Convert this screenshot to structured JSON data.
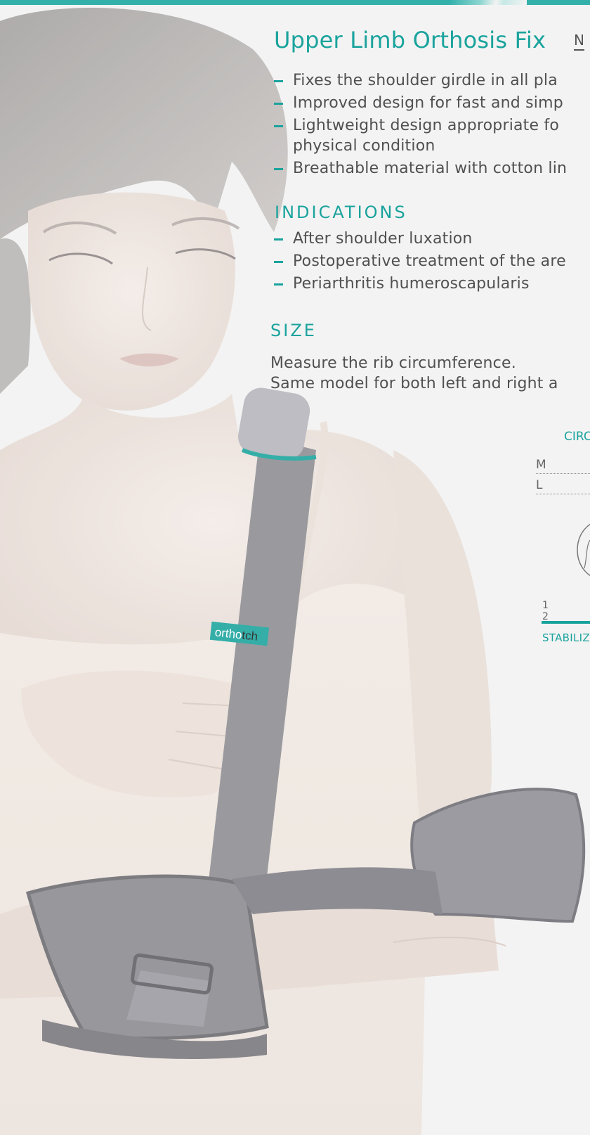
{
  "product": {
    "title": "Upper Limb Orthosis Fix",
    "code": "N"
  },
  "features": [
    "Fixes the shoulder girdle in all pla",
    "Improved design for fast and simp",
    "Lightweight design appropriate fo",
    "physical condition",
    "Breathable material with cotton lin"
  ],
  "indications": {
    "heading": "INDICATIONS",
    "items": [
      "After shoulder luxation",
      "Postoperative treatment of the are",
      "Periarthritis humeroscapularis"
    ]
  },
  "size": {
    "heading": "SIZE",
    "line1": "Measure the rib circumference.",
    "line2": "Same model for both left and right a"
  },
  "size_table": {
    "header": "CIRC",
    "rows": [
      "M",
      "L"
    ]
  },
  "stabilization_scale": {
    "numbers": [
      "1",
      "2"
    ],
    "label": "STABILIZ"
  },
  "strap_label": {
    "part1": "ortho",
    "part2": "tch"
  },
  "colors": {
    "accent": "#1aa39d",
    "text": "#505050",
    "background": "#f2f2f2",
    "brace_gray": "#8c8c91"
  }
}
